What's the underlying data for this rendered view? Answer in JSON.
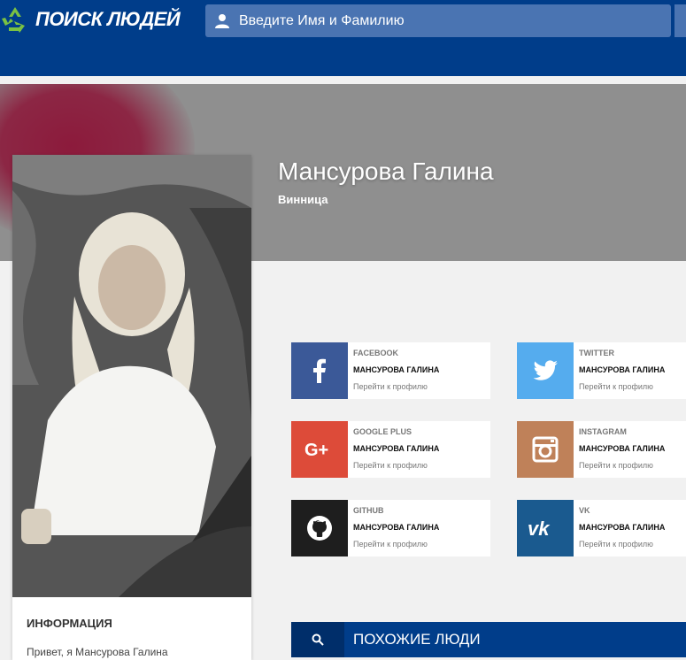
{
  "header": {
    "logo_text": "ПОИСК ЛЮДЕЙ",
    "search_placeholder": "Введите Имя и Фамилию"
  },
  "profile": {
    "name": "Мансурова Галина",
    "city": "Винница"
  },
  "info": {
    "title": "ИНФОРМАЦИЯ",
    "text": "Привет, я Мансурова Галина"
  },
  "socials": [
    {
      "network": "FACEBOOK",
      "name": "МАНСУРОВА ГАЛИНА",
      "link": "Перейти к профилю",
      "icon": "facebook-icon",
      "color": "#3b5998"
    },
    {
      "network": "TWITTER",
      "name": "МАНСУРОВА ГАЛИНА",
      "link": "Перейти к профилю",
      "icon": "twitter-icon",
      "color": "#55acee"
    },
    {
      "network": "GOOGLE PLUS",
      "name": "МАНСУРОВА ГАЛИНА",
      "link": "Перейти к профилю",
      "icon": "google-plus-icon",
      "color": "#dd4b39"
    },
    {
      "network": "INSTAGRAM",
      "name": "МАНСУРОВА ГАЛИНА",
      "link": "Перейти к профилю",
      "icon": "instagram-icon",
      "color": "#bf8159"
    },
    {
      "network": "GITHUB",
      "name": "МАНСУРОВА ГАЛИНА",
      "link": "Перейти к профилю",
      "icon": "github-icon",
      "color": "#1e1e1e"
    },
    {
      "network": "VK",
      "name": "МАНСУРОВА ГАЛИНА",
      "link": "Перейти к профилю",
      "icon": "vk-icon",
      "color": "#1a5a8f"
    }
  ],
  "similar": {
    "title": "ПОХОЖИЕ ЛЮДИ"
  },
  "colors": {
    "header_bg": "#003d8a",
    "hero_bg": "#8f8f8f",
    "accent_blob": "#8c1437"
  }
}
